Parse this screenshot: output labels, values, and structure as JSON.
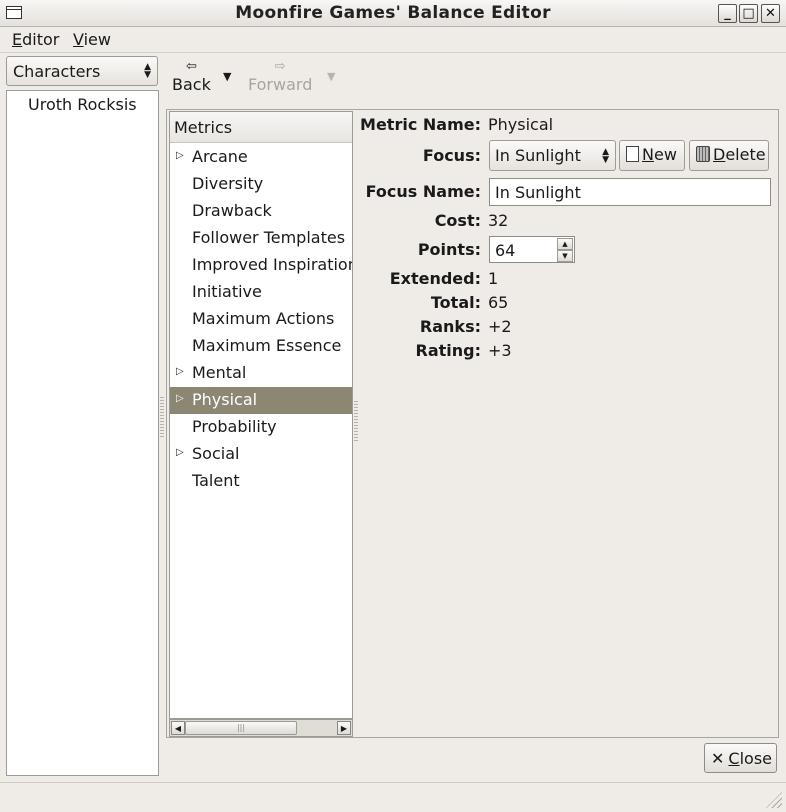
{
  "window": {
    "title": "Moonfire Games' Balance Editor",
    "buttons": {
      "minimize": "_",
      "maximize": "□",
      "close": "✕"
    }
  },
  "menubar": {
    "editor": {
      "mnemonic": "E",
      "rest": "ditor"
    },
    "view": {
      "mnemonic": "V",
      "rest": "iew"
    }
  },
  "sidebar": {
    "category": "Characters",
    "items": [
      "Uroth Rocksis"
    ]
  },
  "toolbar": {
    "back": {
      "label": "Back",
      "enabled": true
    },
    "forward": {
      "label": "Forward",
      "enabled": false
    }
  },
  "metrics": {
    "header": "Metrics",
    "items": [
      {
        "label": "Arcane",
        "expandable": true,
        "selected": false
      },
      {
        "label": "Diversity",
        "expandable": false,
        "selected": false
      },
      {
        "label": "Drawback",
        "expandable": false,
        "selected": false
      },
      {
        "label": "Follower Templates",
        "expandable": false,
        "selected": false
      },
      {
        "label": "Improved Inspiration",
        "expandable": false,
        "selected": false
      },
      {
        "label": "Initiative",
        "expandable": false,
        "selected": false
      },
      {
        "label": "Maximum Actions",
        "expandable": false,
        "selected": false
      },
      {
        "label": "Maximum Essence",
        "expandable": false,
        "selected": false
      },
      {
        "label": "Mental",
        "expandable": true,
        "selected": false
      },
      {
        "label": "Physical",
        "expandable": true,
        "selected": true
      },
      {
        "label": "Probability",
        "expandable": false,
        "selected": false
      },
      {
        "label": "Social",
        "expandable": true,
        "selected": false
      },
      {
        "label": "Talent",
        "expandable": false,
        "selected": false
      }
    ]
  },
  "detail": {
    "metric_name": {
      "label": "Metric Name:",
      "value": "Physical"
    },
    "focus": {
      "label": "Focus:",
      "value": "In Sunlight"
    },
    "new_button": {
      "mnemonic": "N",
      "rest": "ew"
    },
    "delete_button": {
      "mnemonic": "D",
      "rest": "elete"
    },
    "focus_name": {
      "label": "Focus Name:",
      "value": "In Sunlight"
    },
    "cost": {
      "label": "Cost:",
      "value": "32"
    },
    "points": {
      "label": "Points:",
      "value": "64"
    },
    "extended": {
      "label": "Extended:",
      "value": "1"
    },
    "total": {
      "label": "Total:",
      "value": "65"
    },
    "ranks": {
      "label": "Ranks:",
      "value": "+2"
    },
    "rating": {
      "label": "Rating:",
      "value": "+3"
    }
  },
  "footer": {
    "close_button": {
      "mnemonic": "C",
      "rest": "lose"
    }
  }
}
